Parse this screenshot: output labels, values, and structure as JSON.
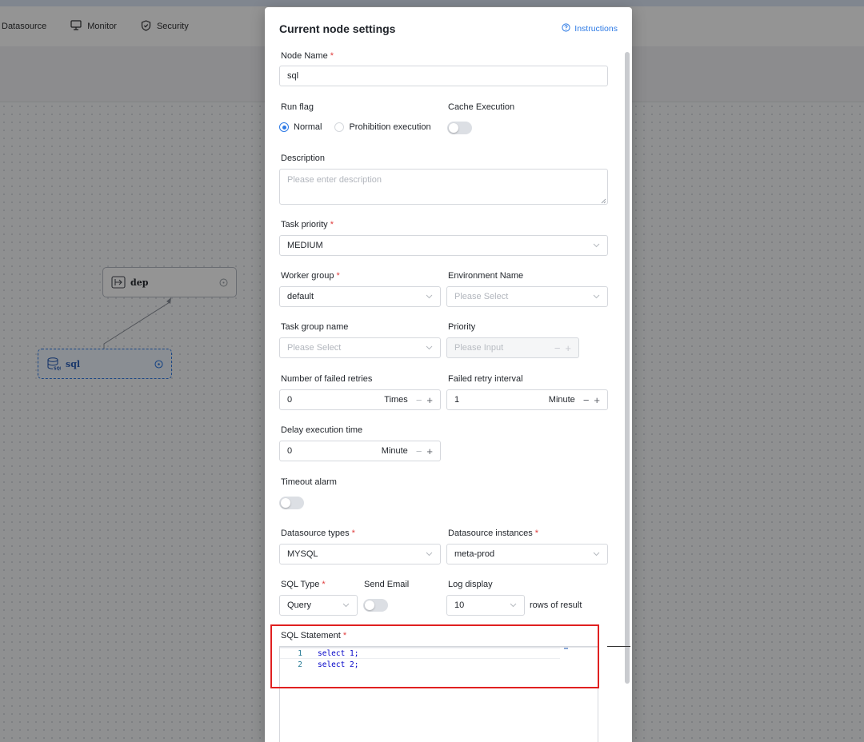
{
  "nav": {
    "items": [
      {
        "label": "Datasource",
        "icon": "none"
      },
      {
        "label": "Monitor",
        "icon": "monitor-icon"
      },
      {
        "label": "Security",
        "icon": "shield-icon"
      }
    ]
  },
  "dag": {
    "nodes": [
      {
        "label": "dep",
        "icon": "dependent-task-icon"
      },
      {
        "label": "sql",
        "icon": "sql-database-icon"
      }
    ]
  },
  "modal": {
    "title": "Current node settings",
    "instructions_label": "Instructions"
  },
  "form": {
    "node_name": {
      "label": "Node Name",
      "required": "*",
      "value": "sql"
    },
    "run_flag": {
      "label": "Run flag",
      "options": [
        "Normal",
        "Prohibition execution"
      ],
      "selected": "Normal"
    },
    "cache_execution": {
      "label": "Cache Execution",
      "enabled": false
    },
    "description": {
      "label": "Description",
      "placeholder": "Please enter description"
    },
    "task_priority": {
      "label": "Task priority",
      "required": "*",
      "value": "MEDIUM"
    },
    "worker_group": {
      "label": "Worker group",
      "required": "*",
      "value": "default"
    },
    "environment_name": {
      "label": "Environment Name",
      "placeholder": "Please Select"
    },
    "task_group_name": {
      "label": "Task group name",
      "placeholder": "Please Select"
    },
    "priority": {
      "label": "Priority",
      "placeholder": "Please Input"
    },
    "failed_retries": {
      "label": "Number of failed retries",
      "value": "0",
      "unit": "Times"
    },
    "retry_interval": {
      "label": "Failed retry interval",
      "value": "1",
      "unit": "Minute"
    },
    "delay_execution": {
      "label": "Delay execution time",
      "value": "0",
      "unit": "Minute"
    },
    "timeout_alarm": {
      "label": "Timeout alarm",
      "enabled": false
    },
    "datasource_types": {
      "label": "Datasource types",
      "required": "*",
      "value": "MYSQL"
    },
    "datasource_instances": {
      "label": "Datasource instances",
      "required": "*",
      "value": "meta-prod"
    },
    "sql_type": {
      "label": "SQL Type",
      "required": "*",
      "value": "Query"
    },
    "send_email": {
      "label": "Send Email",
      "enabled": false
    },
    "log_display": {
      "label": "Log display",
      "value": "10",
      "suffix": "rows of result"
    },
    "sql_statement": {
      "label": "SQL Statement",
      "required": "*",
      "lines": [
        {
          "number": "1",
          "code": "select 1;"
        },
        {
          "number": "2",
          "code": "select 2;"
        }
      ]
    }
  },
  "symbols": {
    "minus": "−",
    "plus": "+"
  },
  "colors": {
    "accent": "#2f7be5",
    "required": "#e03e3e",
    "highlight": "#e02020",
    "sql_keyword": "#0000c8",
    "line_number": "#237893"
  }
}
